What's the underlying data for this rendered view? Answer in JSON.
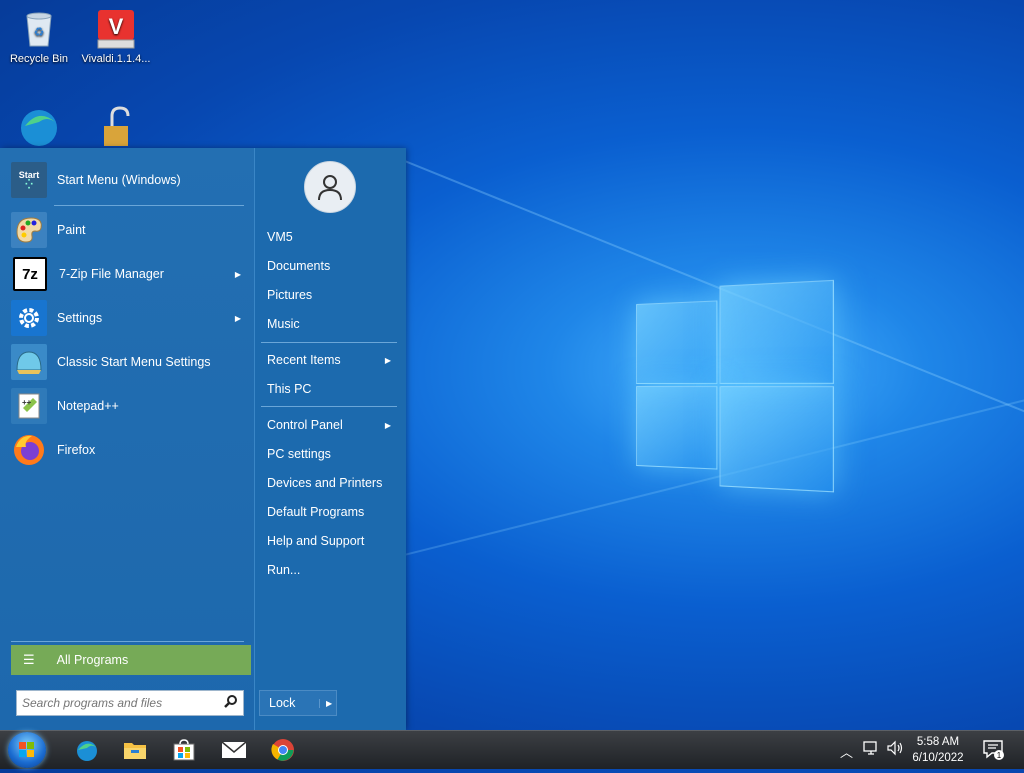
{
  "desktop": {
    "icons": [
      {
        "label": "Recycle Bin"
      },
      {
        "label": "Vivaldi.1.1.4..."
      },
      {
        "label": ""
      },
      {
        "label": ""
      }
    ]
  },
  "start_menu": {
    "programs": [
      {
        "label": "Start Menu (Windows)",
        "icon": "start-menu-icon",
        "submenu": false
      },
      {
        "label": "Paint",
        "icon": "paint-palette-icon",
        "submenu": false
      },
      {
        "label": "7-Zip File Manager",
        "icon": "7zip-icon",
        "icon_text": "7z",
        "submenu": true
      },
      {
        "label": "Settings",
        "icon": "gear-icon",
        "submenu": true
      },
      {
        "label": "Classic Start Menu Settings",
        "icon": "shell-icon",
        "submenu": false
      },
      {
        "label": "Notepad++",
        "icon": "notepad-icon",
        "submenu": false
      },
      {
        "label": "Firefox",
        "icon": "firefox-icon",
        "submenu": false
      }
    ],
    "start_icon_text": "Start",
    "all_programs_label": "All Programs",
    "search_placeholder": "Search programs and files",
    "user_links": [
      "VM5",
      "Documents",
      "Pictures",
      "Music"
    ],
    "recent_items": "Recent Items",
    "this_pc": "This PC",
    "system_links": [
      "Control Panel",
      "PC settings",
      "Devices and Printers",
      "Default Programs",
      "Help and Support",
      "Run..."
    ],
    "lock_label": "Lock",
    "colors": {
      "menu_bg": "#1d6db3",
      "all_programs_bg": "#76aa57"
    }
  },
  "taskbar": {
    "apps": [
      {
        "icon": "edge-icon"
      },
      {
        "icon": "file-explorer-icon"
      },
      {
        "icon": "store-icon"
      },
      {
        "icon": "mail-icon"
      },
      {
        "icon": "chrome-icon"
      }
    ],
    "time": "5:58 AM",
    "date": "6/10/2022",
    "notification_count": "1"
  }
}
